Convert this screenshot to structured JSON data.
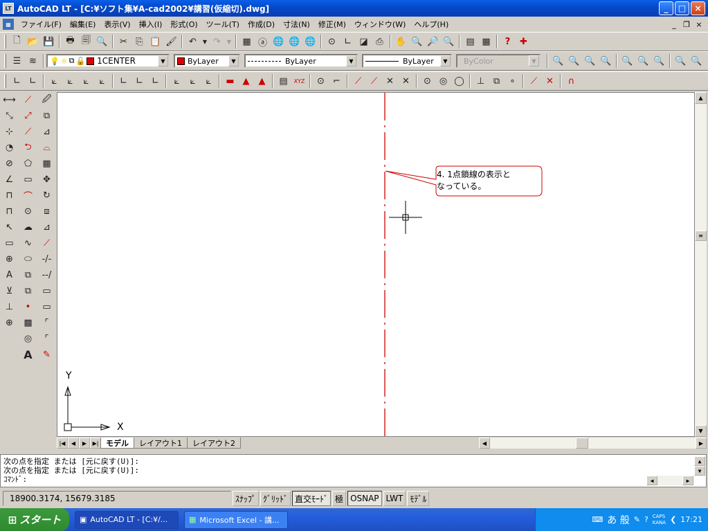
{
  "window": {
    "title": "AutoCAD LT - [C:¥ソフト集¥A-cad2002¥講習(仮縮切).dwg]",
    "app_icon": "LT"
  },
  "menu": [
    "ファイル(F)",
    "編集(E)",
    "表示(V)",
    "挿入(I)",
    "形式(O)",
    "ツール(T)",
    "作成(D)",
    "寸法(N)",
    "修正(M)",
    "ウィンドウ(W)",
    "ヘルプ(H)"
  ],
  "layer": {
    "name": "1CENTER",
    "color": "#dd0000"
  },
  "props": {
    "color": "ByLayer",
    "linetype": "ByLayer",
    "lineweight": "ByLayer",
    "plotstyle": "ByColor"
  },
  "drawing": {
    "annotation": [
      "4. 1点鎖線の表示と",
      "なっている。"
    ],
    "centerline_color": "#cc0000",
    "ucs_x": "X",
    "ucs_y": "Y"
  },
  "tabs": {
    "model": "モデル",
    "layout1": "レイアウト1",
    "layout2": "レイアウト2"
  },
  "command": {
    "line1": "次の点を指定 または [元に戻す(U)]:",
    "line2": "次の点を指定 または [元に戻す(U)]:",
    "prompt": "ｺﾏﾝﾄﾞ:"
  },
  "status": {
    "coords": "18900.3174, 15679.3185",
    "snap": "ｽﾅｯﾌﾟ",
    "grid": "ｸﾞﾘｯﾄﾞ",
    "ortho": "直交ﾓｰﾄﾞ",
    "polar": "極",
    "osnap": "OSNAP",
    "lwt": "LWT",
    "model": "ﾓﾃﾞﾙ"
  },
  "taskbar": {
    "start": "スタート",
    "task1": "AutoCAD LT - [C:¥/...",
    "task2": "Microsoft Excel - 講...",
    "ime": "あ 般",
    "caps": "CAPS",
    "kana": "KANA",
    "time": "17:21"
  }
}
